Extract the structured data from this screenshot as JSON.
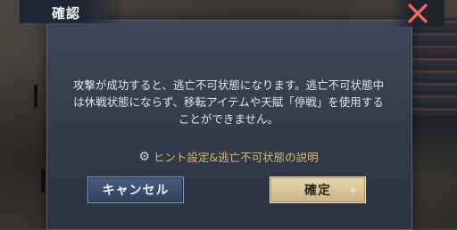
{
  "dialog": {
    "title": "確認",
    "message": "攻撃が成功すると、逃亡不可状態になります。逃亡不可状態中は休戦状態にならず、移転アイテムや天賦「停戦」を使用することができません。",
    "hint_icon": "gear-icon",
    "hint_link": "ヒント設定&逃亡不可状態の説明",
    "close_icon": "close-x-icon",
    "cancel_label": "キャンセル",
    "confirm_label": "確定"
  },
  "colors": {
    "hint_text": "#d9b874",
    "close_x": "#e0534a",
    "confirm_button": "#e6d7ae",
    "cancel_button": "#3f5274"
  }
}
